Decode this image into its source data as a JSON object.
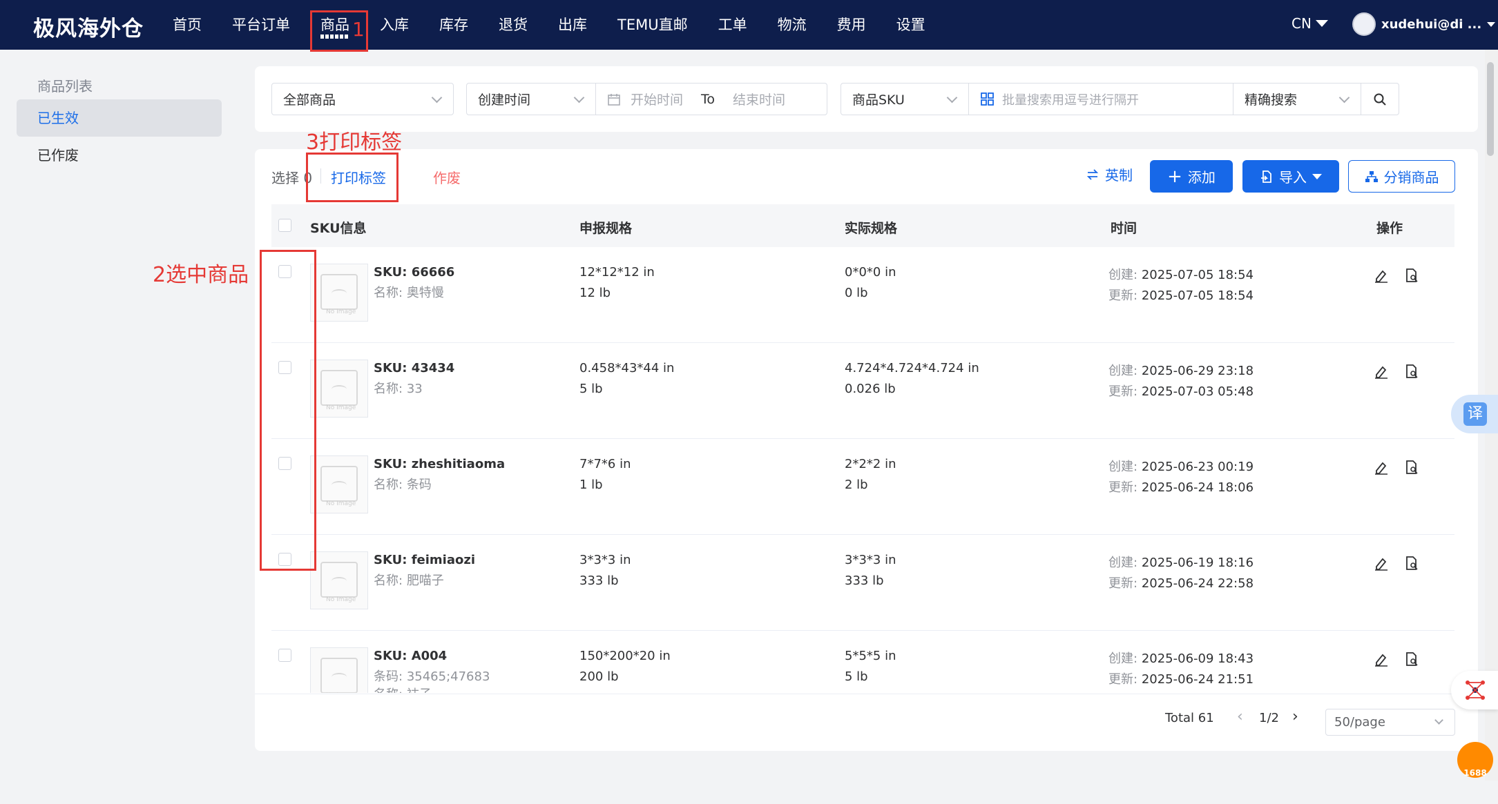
{
  "header": {
    "logo": "极风海外仓",
    "nav": [
      "首页",
      "平台订单",
      "商品",
      "入库",
      "库存",
      "退货",
      "出库",
      "TEMU直邮",
      "工单",
      "物流",
      "费用",
      "设置"
    ],
    "active_nav": "商品",
    "lang": "CN",
    "user": "xudehui@di ..."
  },
  "sidebar": {
    "title": "商品列表",
    "items": [
      "已生效",
      "已作废"
    ]
  },
  "filters": {
    "scope": "全部商品",
    "time_type": "创建时间",
    "start_placeholder": "开始时间",
    "to": "To",
    "end_placeholder": "结束时间",
    "search_field": "商品SKU",
    "search_placeholder": "批量搜索用逗号进行隔开",
    "match_mode": "精确搜索"
  },
  "toolbar": {
    "selected_label": "选择",
    "selected_count": "0",
    "print_label": "打印标签",
    "void_label": "作废",
    "unit_label": "英制",
    "add_label": "添加",
    "import_label": "导入",
    "distribute_label": "分销商品"
  },
  "table": {
    "columns": [
      "SKU信息",
      "申报规格",
      "实际规格",
      "时间",
      "操作"
    ],
    "sku_prefix": "SKU:",
    "created_prefix": "创建:",
    "updated_prefix": "更新:",
    "rows": [
      {
        "sku": "66666",
        "name_label": "名称:",
        "name": "奥特慢",
        "declared_dims": "12*12*12 in",
        "declared_weight": "12 lb",
        "actual_dims": "0*0*0 in",
        "actual_weight": "0 lb",
        "created": "2025-07-05 18:54",
        "updated": "2025-07-05 18:54"
      },
      {
        "sku": "43434",
        "name_label": "名称:",
        "name": "33",
        "declared_dims": "0.458*43*44 in",
        "declared_weight": "5 lb",
        "actual_dims": "4.724*4.724*4.724 in",
        "actual_weight": "0.026 lb",
        "created": "2025-06-29 23:18",
        "updated": "2025-07-03 05:48"
      },
      {
        "sku": "zheshitiaoma",
        "name_label": "名称:",
        "name": "条码",
        "declared_dims": "7*7*6 in",
        "declared_weight": "1 lb",
        "actual_dims": "2*2*2 in",
        "actual_weight": "2 lb",
        "created": "2025-06-23 00:19",
        "updated": "2025-06-24 18:06"
      },
      {
        "sku": "feimiaozi",
        "name_label": "名称:",
        "name": "肥喵子",
        "declared_dims": "3*3*3 in",
        "declared_weight": "333 lb",
        "actual_dims": "3*3*3 in",
        "actual_weight": "333 lb",
        "created": "2025-06-19 18:16",
        "updated": "2025-06-24 22:58"
      },
      {
        "sku": "A004",
        "barcode_label": "条码:",
        "barcode": "35465;47683",
        "name_label": "名称:",
        "name": "袜子",
        "declared_dims": "150*200*20 in",
        "declared_weight": "200 lb",
        "actual_dims": "5*5*5 in",
        "actual_weight": "5 lb",
        "created": "2025-06-09 18:43",
        "updated": "2025-06-24 21:51"
      }
    ],
    "no_image_text": "No Image"
  },
  "pagination": {
    "total": "Total 61",
    "page": "1/2",
    "page_size": "50/page"
  },
  "annotations": {
    "step1": "1",
    "step2": "2选中商品",
    "step3": "3打印标签"
  },
  "floating": {
    "translate": "译",
    "badge": "1688"
  }
}
